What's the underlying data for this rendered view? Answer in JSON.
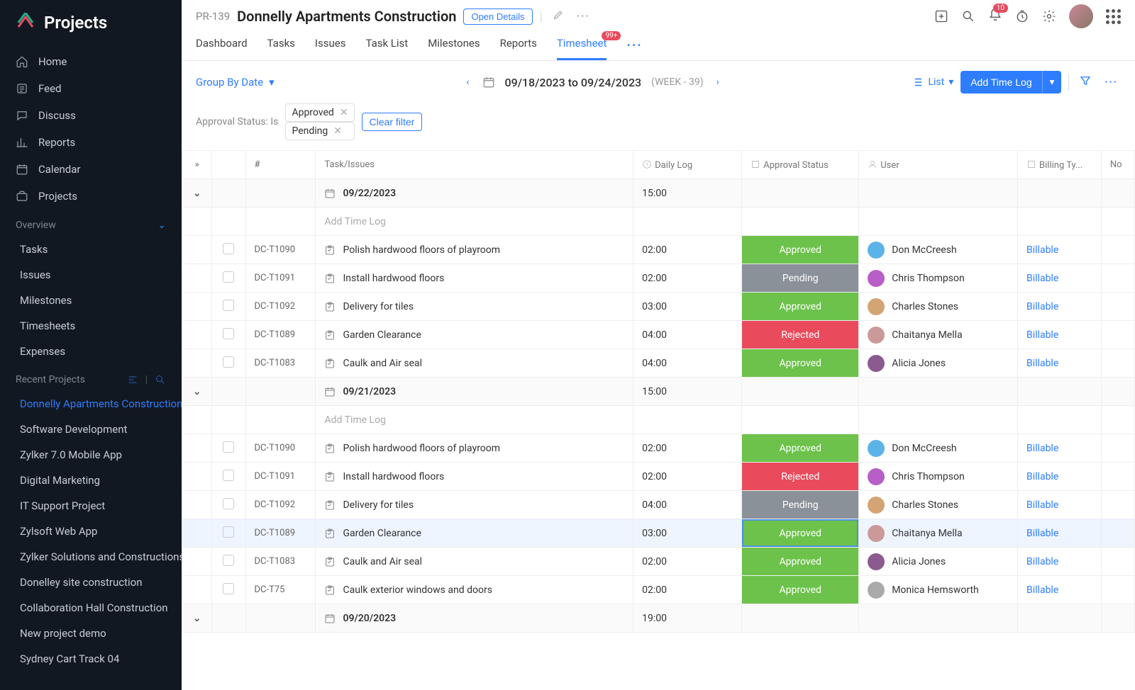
{
  "brand": "Projects",
  "nav": [
    {
      "icon": "home",
      "label": "Home"
    },
    {
      "icon": "feed",
      "label": "Feed"
    },
    {
      "icon": "chat",
      "label": "Discuss"
    },
    {
      "icon": "report",
      "label": "Reports"
    },
    {
      "icon": "calendar",
      "label": "Calendar"
    },
    {
      "icon": "briefcase",
      "label": "Projects"
    }
  ],
  "overviewLabel": "Overview",
  "overviewItems": [
    "Tasks",
    "Issues",
    "Milestones",
    "Timesheets",
    "Expenses"
  ],
  "recentLabel": "Recent Projects",
  "recentProjects": [
    "Donnelly Apartments Construction",
    "Software Development",
    "Zylker 7.0 Mobile App",
    "Digital Marketing",
    "IT Support Project",
    "Zylsoft Web App",
    "Zylker Solutions and Constructions",
    "Donelley site construction",
    "Collaboration Hall Construction",
    "New project demo",
    "Sydney Cart Track 04"
  ],
  "header": {
    "projectId": "PR-139",
    "projectTitle": "Donnelly Apartments Construction",
    "openDetails": "Open Details",
    "notifCount": "10",
    "tabs": [
      "Dashboard",
      "Tasks",
      "Issues",
      "Task List",
      "Milestones",
      "Reports"
    ],
    "activeTab": "Timesheet",
    "activeBadge": "99+"
  },
  "toolbar": {
    "groupBy": "Group By Date",
    "dateRange": "09/18/2023 to 09/24/2023",
    "weekLabel": "(WEEK - 39)",
    "viewLabel": "List",
    "addLog": "Add Time Log"
  },
  "filter": {
    "label": "Approval Status: Is",
    "chips": [
      "Approved",
      "Pending"
    ],
    "clear": "Clear filter"
  },
  "columns": [
    "#",
    "Task/Issues",
    "Daily Log",
    "Approval Status",
    "User",
    "Billing Ty...",
    "No"
  ],
  "addLogPlaceholder": "Add Time Log",
  "groups": [
    {
      "date": "09/22/2023",
      "total": "15:00",
      "entries": [
        {
          "id": "DC-T1090",
          "task": "Polish hardwood floors of playroom",
          "time": "02:00",
          "status": "Approved",
          "user": "Don McCreesh",
          "avatar": "#5bb3e8",
          "billing": "Billable"
        },
        {
          "id": "DC-T1091",
          "task": "Install hardwood floors",
          "time": "02:00",
          "status": "Pending",
          "user": "Chris Thompson",
          "avatar": "#b85fc7",
          "billing": "Billable"
        },
        {
          "id": "DC-T1092",
          "task": "Delivery for tiles",
          "time": "03:00",
          "status": "Approved",
          "user": "Charles Stones",
          "avatar": "#d4a574",
          "billing": "Billable"
        },
        {
          "id": "DC-T1089",
          "task": "Garden Clearance",
          "time": "04:00",
          "status": "Rejected",
          "user": "Chaitanya Mella",
          "avatar": "#c99",
          "billing": "Billable"
        },
        {
          "id": "DC-T1083",
          "task": "Caulk and Air seal",
          "time": "04:00",
          "status": "Approved",
          "user": "Alicia Jones",
          "avatar": "#8b5a8f",
          "billing": "Billable"
        }
      ]
    },
    {
      "date": "09/21/2023",
      "total": "15:00",
      "entries": [
        {
          "id": "DC-T1090",
          "task": "Polish hardwood floors of playroom",
          "time": "02:00",
          "status": "Approved",
          "user": "Don McCreesh",
          "avatar": "#5bb3e8",
          "billing": "Billable"
        },
        {
          "id": "DC-T1091",
          "task": "Install hardwood floors",
          "time": "02:00",
          "status": "Rejected",
          "user": "Chris Thompson",
          "avatar": "#b85fc7",
          "billing": "Billable"
        },
        {
          "id": "DC-T1092",
          "task": "Delivery for tiles",
          "time": "04:00",
          "status": "Pending",
          "user": "Charles Stones",
          "avatar": "#d4a574",
          "billing": "Billable"
        },
        {
          "id": "DC-T1089",
          "task": "Garden Clearance",
          "time": "03:00",
          "status": "Approved",
          "user": "Chaitanya Mella",
          "avatar": "#c99",
          "billing": "Billable",
          "highlighted": true
        },
        {
          "id": "DC-T1083",
          "task": "Caulk and Air seal",
          "time": "02:00",
          "status": "Approved",
          "user": "Alicia Jones",
          "avatar": "#8b5a8f",
          "billing": "Billable"
        },
        {
          "id": "DC-T75",
          "task": "Caulk exterior windows and doors",
          "time": "02:00",
          "status": "Approved",
          "user": "Monica Hemsworth",
          "avatar": "#aaa",
          "billing": "Billable"
        }
      ]
    },
    {
      "date": "09/20/2023",
      "total": "19:00",
      "entries": []
    }
  ]
}
